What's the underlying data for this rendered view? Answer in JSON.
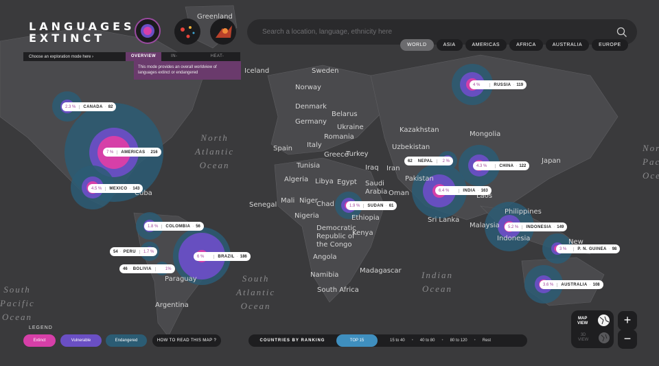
{
  "app": {
    "title_line1": "LANGUAGES",
    "title_line2": "EXTINCT"
  },
  "explore": {
    "label": "Choose an exploration mode here  ›",
    "tabs": [
      "OVERVIEW",
      "IN- DEPTH",
      "HEAT-MAP"
    ],
    "active_tab": "OVERVIEW",
    "description": "This mode provides an overall worldview of languages extinct or endangered"
  },
  "search": {
    "placeholder": "Search a location, language, ethnicity here"
  },
  "regions": [
    "WORLD",
    "ASIA",
    "AMERICAS",
    "AFRICA",
    "AUSTRALIA",
    "EUROPE"
  ],
  "active_region": "WORLD",
  "geo_labels": [
    "Greenland",
    "Iceland",
    "Sweden",
    "Norway",
    "Denmark",
    "Belarus",
    "Germany",
    "Ukraine",
    "Romania",
    "Kazakhstan",
    "Mongolia",
    "Uzbekistan",
    "Spain",
    "Italy",
    "Greece",
    "Turkey",
    "Tunisia",
    "Iraq",
    "Iran",
    "Japan",
    "Algeria",
    "Libya",
    "Egypt",
    "Saudi",
    "Arabia",
    "Pakistan",
    "Mali",
    "Niger",
    "Chad",
    "Senegal",
    "Nigeria",
    "Ethiopia",
    "Oman",
    "Laos",
    "Philippines",
    "Sri Lanka",
    "Malaysia",
    "Indonesia",
    "Democratic",
    "Republic of",
    "the Congo",
    "Kenya",
    "Angola",
    "Namibia",
    "Madagascar",
    "South Africa",
    "Paraguay",
    "Argentina",
    "New",
    "Cuba"
  ],
  "ocean_labels": [
    "North\nAtlantic\nOcean",
    "South\nAtlantic\nOcean",
    "Indian\nOcean",
    "South\nPacific\nOcean",
    "North\nPacific\nOcean"
  ],
  "markers": [
    {
      "pct": "2.3 %",
      "name": "CANADA",
      "count": "82"
    },
    {
      "pct": "7 %",
      "name": "AMERICAS",
      "count": "216"
    },
    {
      "pct": "4.5 %",
      "name": "MEXICO",
      "count": "143"
    },
    {
      "pct": "1.8 %",
      "name": "COLOMBIA",
      "count": "56"
    },
    {
      "pct": "1.7 %",
      "name": "PERU",
      "count": "54"
    },
    {
      "pct": "1%",
      "name": "BOLIVIA",
      "count": "46"
    },
    {
      "pct": "6 %",
      "name": "BRAZIL",
      "count": "186"
    },
    {
      "pct": "4 %",
      "name": "RUSSIA",
      "count": "119"
    },
    {
      "pct": "2 %",
      "name": "NEPAL",
      "count": "62"
    },
    {
      "pct": "4.3 %",
      "name": "CHINA",
      "count": "122"
    },
    {
      "pct": "6.4 %",
      "name": "INDIA",
      "count": "163"
    },
    {
      "pct": "1.9 %",
      "name": "SUDAN",
      "count": "61"
    },
    {
      "pct": "5.2 %",
      "name": "INDONESIA",
      "count": "149"
    },
    {
      "pct": "3 %",
      "name": "P. N. GUINEA",
      "count": "98"
    },
    {
      "pct": "3.6 %",
      "name": "AUSTRALIA",
      "count": "108"
    }
  ],
  "legend": {
    "title": "LEGEND",
    "items": [
      {
        "label": "Extinct",
        "color": "#d63fa8"
      },
      {
        "label": "Vulnerable",
        "color": "#6a4fc4"
      },
      {
        "label": "Endangered",
        "color": "#2b5c74"
      }
    ],
    "help_label": "HOW TO READ THIS MAP ?"
  },
  "ranking": {
    "title": "COUNTRIES BY RANKING",
    "options": [
      "TOP 15",
      "15 to 40",
      "40 to 80",
      "80 to 120",
      "Rest"
    ],
    "active": "TOP 15"
  },
  "view": {
    "map_label": "MAP\nVIEW",
    "globe_label": "3D\nVIEW"
  },
  "zoom": {
    "in": "+",
    "out": "−"
  },
  "colors": {
    "extinct": "#d63fa8",
    "vulnerable": "#6a4fc4",
    "endangered": "#2b5c74",
    "accent": "#6a3a6c",
    "active_rank": "#3f8fbf"
  }
}
